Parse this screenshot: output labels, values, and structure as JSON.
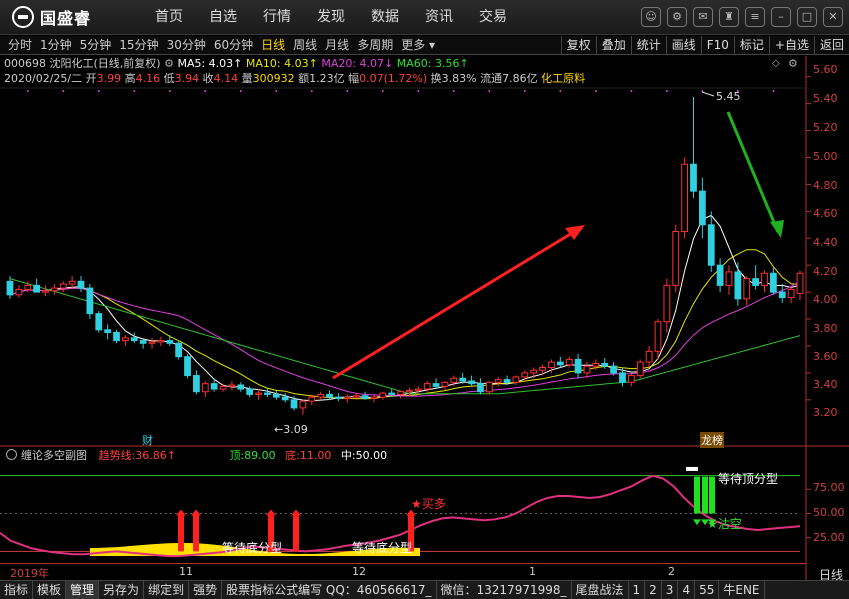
{
  "app": {
    "logo_text": "国盛睿",
    "nav": [
      "首页",
      "自选",
      "行情",
      "发现",
      "数据",
      "资讯",
      "交易"
    ]
  },
  "periods": [
    "分时",
    "1分钟",
    "5分钟",
    "15分钟",
    "30分钟",
    "60分钟",
    "日线",
    "周线",
    "月线",
    "多周期",
    "更多"
  ],
  "active_period": "日线",
  "tools": [
    "复权",
    "叠加",
    "统计",
    "画线",
    "F10",
    "标记",
    "+自选",
    "返回"
  ],
  "stock": {
    "code_name": "000698 沈阳化工",
    "mode": "(日线,前复权)",
    "ma5": "MA5: 4.03↑",
    "ma10": "MA10: 4.03↑",
    "ma20": "MA20: 4.07↓",
    "ma60": "MA60: 3.56↑",
    "date": "2020/02/25/二",
    "open_label": "开",
    "open": "3.99",
    "high_label": "高",
    "high": "4.16",
    "low_label": "低",
    "low": "3.94",
    "close_label": "收",
    "close": "4.14",
    "vol_label": "量",
    "vol": "300932",
    "amount_label": "额",
    "amount": "1.23亿",
    "change_label": "幅",
    "change": "0.07(1.72%)",
    "turnover_label": "换",
    "turnover": "3.83%",
    "float_label": "流通",
    "float": "7.86亿",
    "sector": "化工原料"
  },
  "price_axis": [
    "5.60",
    "5.40",
    "5.20",
    "5.00",
    "4.80",
    "4.60",
    "4.40",
    "4.20",
    "4.00",
    "3.80",
    "3.60",
    "3.40",
    "3.20"
  ],
  "price_annotations": {
    "high_mark": "5.45",
    "low_mark": "3.09",
    "cai": "财",
    "longhu": "龙榜"
  },
  "sub": {
    "title": "缠论多空副图",
    "trend_label": "趋势线:",
    "trend_value": "36.86↑",
    "top_label": "顶:",
    "top_value": "89.00",
    "bottom_label": "底:",
    "bottom_value": "11.00",
    "mid_label": "中:",
    "mid_value": "50.00",
    "axis": [
      "75.00",
      "50.00",
      "25.00"
    ],
    "signals": {
      "buy": "买多",
      "sell": "沽空",
      "wait_bottom": "等待底分型",
      "wait_top": "等待顶分型"
    }
  },
  "time_axis": [
    "2019年",
    "11",
    "12",
    "1",
    "2"
  ],
  "bottom_bar": [
    "指标",
    "模板",
    "管理",
    "另存为",
    "绑定到",
    "强势",
    "股票指标公式编写 QQ：460566617_",
    "微信：13217971998_",
    "尾盘战法",
    "1",
    "2",
    "3",
    "4",
    "55",
    "牛ENE"
  ],
  "bottom_active": "管理",
  "day_label": "日线",
  "colors": {
    "up": "#ff3030",
    "down": "#30d0e0",
    "ma5": "#ffffff",
    "ma10": "#e8e800",
    "ma20": "#e040e0",
    "ma60": "#30c030",
    "arrow_up": "#ff2020",
    "arrow_down": "#20b020"
  },
  "chart_data": {
    "type": "candlestick",
    "ylim": [
      3.05,
      5.65
    ],
    "candles": [
      [
        4.08,
        4.12,
        3.95,
        3.98
      ],
      [
        3.98,
        4.05,
        3.96,
        4.02
      ],
      [
        4.02,
        4.08,
        4.0,
        4.05
      ],
      [
        4.05,
        4.1,
        4.0,
        4.0
      ],
      [
        4.0,
        4.05,
        3.97,
        4.01
      ],
      [
        4.01,
        4.06,
        3.98,
        4.03
      ],
      [
        4.03,
        4.08,
        4.0,
        4.06
      ],
      [
        4.06,
        4.12,
        4.03,
        4.08
      ],
      [
        4.08,
        4.12,
        4.0,
        4.03
      ],
      [
        4.03,
        4.06,
        3.8,
        3.84
      ],
      [
        3.84,
        3.86,
        3.7,
        3.72
      ],
      [
        3.72,
        3.76,
        3.65,
        3.7
      ],
      [
        3.7,
        3.72,
        3.62,
        3.64
      ],
      [
        3.64,
        3.68,
        3.6,
        3.66
      ],
      [
        3.66,
        3.7,
        3.62,
        3.64
      ],
      [
        3.64,
        3.66,
        3.58,
        3.62
      ],
      [
        3.62,
        3.66,
        3.58,
        3.63
      ],
      [
        3.63,
        3.67,
        3.6,
        3.64
      ],
      [
        3.64,
        3.68,
        3.6,
        3.62
      ],
      [
        3.62,
        3.64,
        3.5,
        3.52
      ],
      [
        3.52,
        3.54,
        3.36,
        3.38
      ],
      [
        3.38,
        3.42,
        3.24,
        3.26
      ],
      [
        3.26,
        3.34,
        3.22,
        3.32
      ],
      [
        3.32,
        3.36,
        3.26,
        3.28
      ],
      [
        3.28,
        3.32,
        3.26,
        3.3
      ],
      [
        3.3,
        3.34,
        3.27,
        3.31
      ],
      [
        3.31,
        3.33,
        3.26,
        3.28
      ],
      [
        3.28,
        3.3,
        3.22,
        3.24
      ],
      [
        3.24,
        3.28,
        3.2,
        3.25
      ],
      [
        3.25,
        3.28,
        3.22,
        3.24
      ],
      [
        3.24,
        3.27,
        3.2,
        3.22
      ],
      [
        3.22,
        3.25,
        3.18,
        3.2
      ],
      [
        3.2,
        3.23,
        3.12,
        3.14
      ],
      [
        3.14,
        3.2,
        3.09,
        3.19
      ],
      [
        3.19,
        3.24,
        3.16,
        3.22
      ],
      [
        3.22,
        3.26,
        3.2,
        3.24
      ],
      [
        3.24,
        3.27,
        3.2,
        3.22
      ],
      [
        3.22,
        3.25,
        3.19,
        3.21
      ],
      [
        3.21,
        3.24,
        3.18,
        3.22
      ],
      [
        3.22,
        3.25,
        3.2,
        3.23
      ],
      [
        3.23,
        3.26,
        3.2,
        3.21
      ],
      [
        3.21,
        3.24,
        3.18,
        3.22
      ],
      [
        3.22,
        3.26,
        3.2,
        3.25
      ],
      [
        3.25,
        3.28,
        3.22,
        3.24
      ],
      [
        3.24,
        3.27,
        3.21,
        3.26
      ],
      [
        3.26,
        3.29,
        3.23,
        3.27
      ],
      [
        3.27,
        3.3,
        3.24,
        3.28
      ],
      [
        3.28,
        3.34,
        3.26,
        3.32
      ],
      [
        3.32,
        3.36,
        3.28,
        3.3
      ],
      [
        3.3,
        3.34,
        3.27,
        3.33
      ],
      [
        3.33,
        3.38,
        3.3,
        3.36
      ],
      [
        3.36,
        3.4,
        3.32,
        3.34
      ],
      [
        3.34,
        3.38,
        3.3,
        3.32
      ],
      [
        3.32,
        3.36,
        3.24,
        3.26
      ],
      [
        3.26,
        3.34,
        3.24,
        3.33
      ],
      [
        3.33,
        3.37,
        3.3,
        3.35
      ],
      [
        3.35,
        3.38,
        3.31,
        3.33
      ],
      [
        3.33,
        3.38,
        3.31,
        3.37
      ],
      [
        3.37,
        3.42,
        3.34,
        3.4
      ],
      [
        3.4,
        3.44,
        3.36,
        3.42
      ],
      [
        3.42,
        3.46,
        3.38,
        3.44
      ],
      [
        3.44,
        3.5,
        3.4,
        3.48
      ],
      [
        3.48,
        3.52,
        3.44,
        3.46
      ],
      [
        3.46,
        3.52,
        3.44,
        3.5
      ],
      [
        3.5,
        3.54,
        3.36,
        3.4
      ],
      [
        3.4,
        3.48,
        3.36,
        3.45
      ],
      [
        3.45,
        3.5,
        3.42,
        3.47
      ],
      [
        3.47,
        3.51,
        3.43,
        3.45
      ],
      [
        3.45,
        3.48,
        3.38,
        3.4
      ],
      [
        3.4,
        3.44,
        3.3,
        3.33
      ],
      [
        3.33,
        3.4,
        3.3,
        3.38
      ],
      [
        3.38,
        3.5,
        3.36,
        3.48
      ],
      [
        3.48,
        3.6,
        3.44,
        3.56
      ],
      [
        3.56,
        3.8,
        3.5,
        3.78
      ],
      [
        3.78,
        4.1,
        3.7,
        4.05
      ],
      [
        4.05,
        4.5,
        4.0,
        4.45
      ],
      [
        4.45,
        5.0,
        4.4,
        4.95
      ],
      [
        4.95,
        5.45,
        4.7,
        4.75
      ],
      [
        4.75,
        4.85,
        4.4,
        4.5
      ],
      [
        4.5,
        4.6,
        4.15,
        4.2
      ],
      [
        4.2,
        4.25,
        4.0,
        4.05
      ],
      [
        4.05,
        4.2,
        3.98,
        4.15
      ],
      [
        4.15,
        4.22,
        3.9,
        3.95
      ],
      [
        3.95,
        4.12,
        3.9,
        4.1
      ],
      [
        4.1,
        4.2,
        4.02,
        4.05
      ],
      [
        4.05,
        4.16,
        4.0,
        4.14
      ],
      [
        4.14,
        4.18,
        3.98,
        4.0
      ],
      [
        4.0,
        4.06,
        3.92,
        3.96
      ],
      [
        3.96,
        4.04,
        3.92,
        4.02
      ],
      [
        3.99,
        4.16,
        3.94,
        4.14
      ]
    ]
  }
}
